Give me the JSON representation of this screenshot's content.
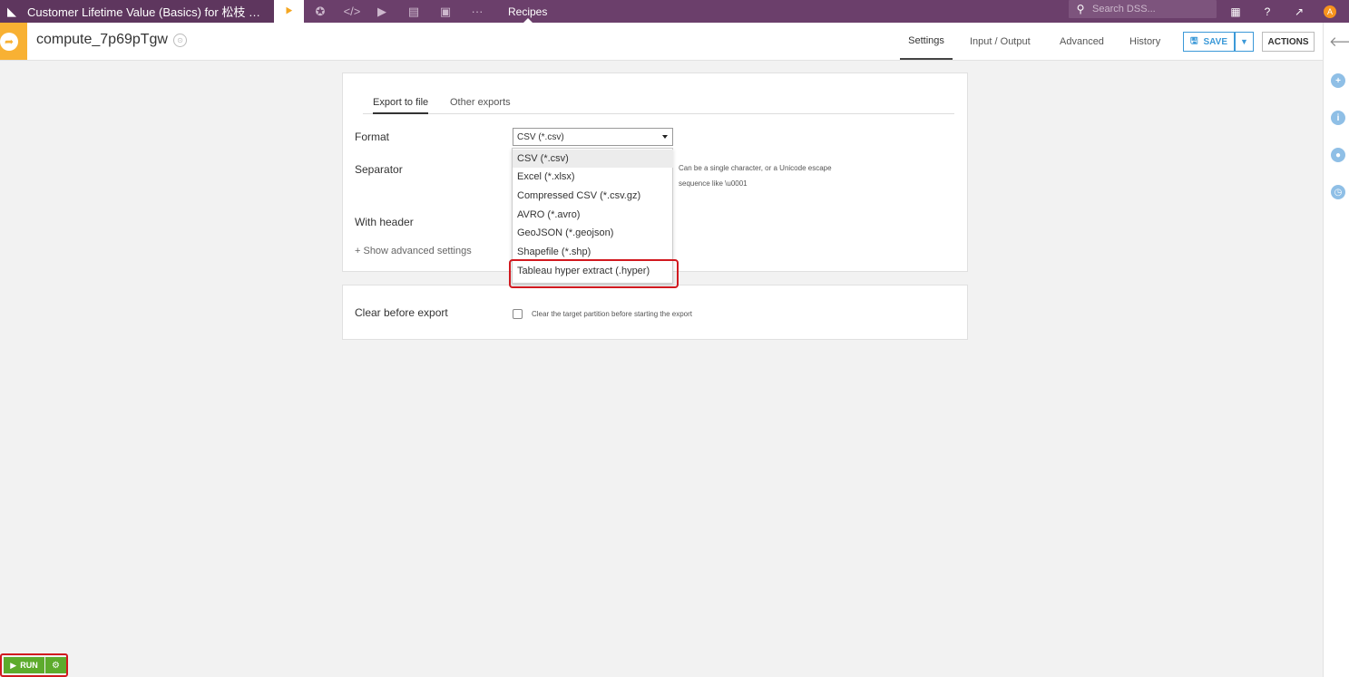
{
  "topnav": {
    "project_title": "Customer Lifetime Value (Basics) for 松枝 …",
    "recipes_label": "Recipes",
    "search_placeholder": "Search DSS...",
    "avatar_initial": "A",
    "icons": [
      "bird-logo-icon",
      "flow-icon",
      "lab-icon",
      "code-icon",
      "run-icon",
      "dashboard-icon",
      "notebook-icon",
      "more-icon",
      "search-icon",
      "apps-grid-icon",
      "help-icon",
      "activity-icon"
    ]
  },
  "recipe": {
    "name": "compute_7p69pTgw",
    "tabs": [
      "Settings",
      "Input / Output",
      "Advanced",
      "History"
    ],
    "active_tab": "Settings",
    "save_label": "SAVE",
    "actions_label": "ACTIONS"
  },
  "export_panel": {
    "subtabs": [
      "Export to file",
      "Other exports"
    ],
    "format_label": "Format",
    "format_value": "CSV (*.csv)",
    "separator_label": "Separator",
    "separator_hint_line1": "Can be a single character, or a Unicode escape",
    "separator_hint_line2": "sequence like \\u0001",
    "with_header_label": "With header",
    "advanced_link": "+ Show advanced settings"
  },
  "format_dropdown": {
    "options": [
      "CSV (*.csv)",
      "Excel (*.xlsx)",
      "Compressed CSV (*.csv.gz)",
      "AVRO (*.avro)",
      "GeoJSON (*.geojson)",
      "Shapefile (*.shp)",
      "Tableau hyper extract (.hyper)"
    ],
    "selected": "CSV (*.csv)",
    "highlighted": "Tableau hyper extract (.hyper)"
  },
  "clear_panel": {
    "label": "Clear before export",
    "checkbox_text": "Clear the target partition before starting the export",
    "checked": false
  },
  "run": {
    "label": "RUN"
  },
  "colors": {
    "topnav": "#6b3f6b",
    "recipe_accent": "#f8b133",
    "save_blue": "#3b99d8",
    "run_green": "#5dab2c",
    "highlight_red": "#d1191f"
  }
}
